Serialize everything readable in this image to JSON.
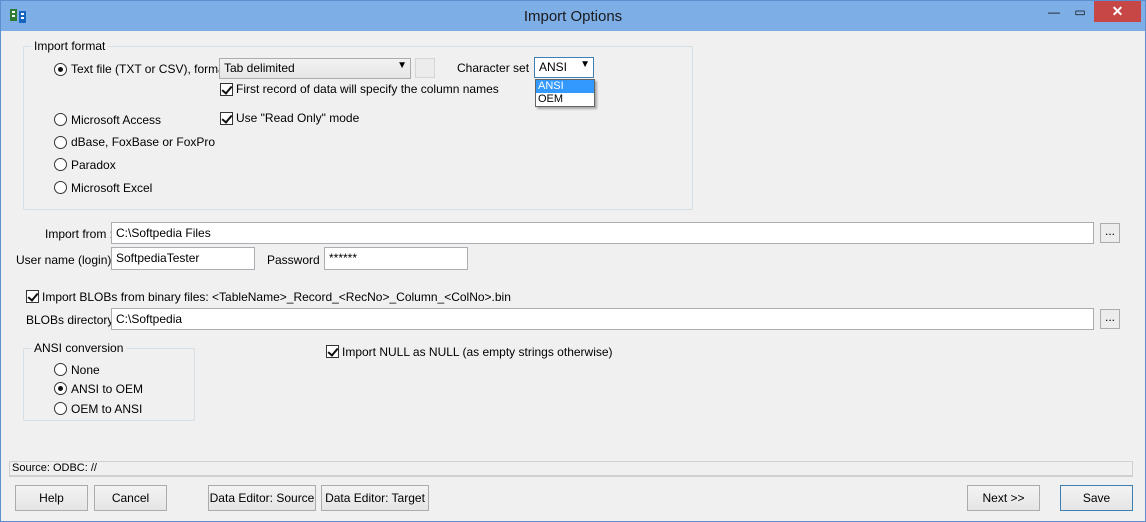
{
  "window": {
    "title": "Import Options"
  },
  "titlebar": {
    "minimize": "—",
    "maximize": "▭",
    "close": "✕"
  },
  "import_format": {
    "group_title": "Import format",
    "options": [
      {
        "label": "Text file (TXT or CSV), format",
        "selected": true
      },
      {
        "label": "Microsoft Access",
        "selected": false
      },
      {
        "label": "dBase, FoxBase or FoxPro",
        "selected": false
      },
      {
        "label": "Paradox",
        "selected": false
      },
      {
        "label": "Microsoft Excel",
        "selected": false
      }
    ],
    "format_value": "Tab delimited",
    "charset_label": "Character set",
    "charset_value": "ANSI",
    "charset_options": [
      "ANSI",
      "OEM"
    ],
    "first_record_label": "First record of data will specify the column names",
    "read_only_label": "Use \"Read Only\" mode"
  },
  "import_from": {
    "label": "Import from :",
    "value": "C:\\Softpedia Files",
    "browse": "..."
  },
  "user": {
    "label": "User name (login):",
    "value": "SoftpediaTester"
  },
  "password": {
    "label": "Password",
    "value": "******"
  },
  "blobs": {
    "checkbox_label": "Import BLOBs from binary files: <TableName>_Record_<RecNo>_Column_<ColNo>.bin",
    "dir_label": "BLOBs directory",
    "dir_value": "C:\\Softpedia",
    "browse": "..."
  },
  "ansi_conversion": {
    "group_title": "ANSI conversion",
    "options": [
      {
        "label": "None",
        "selected": false
      },
      {
        "label": "ANSI to OEM",
        "selected": true
      },
      {
        "label": "OEM to ANSI",
        "selected": false
      }
    ]
  },
  "null_label": "Import NULL as NULL (as empty strings otherwise)",
  "status": "Source: ODBC: //",
  "buttons": {
    "help": "Help",
    "cancel": "Cancel",
    "editor_source": "Data Editor: Source",
    "editor_target": "Data Editor: Target",
    "next": "Next >>",
    "save": "Save"
  }
}
